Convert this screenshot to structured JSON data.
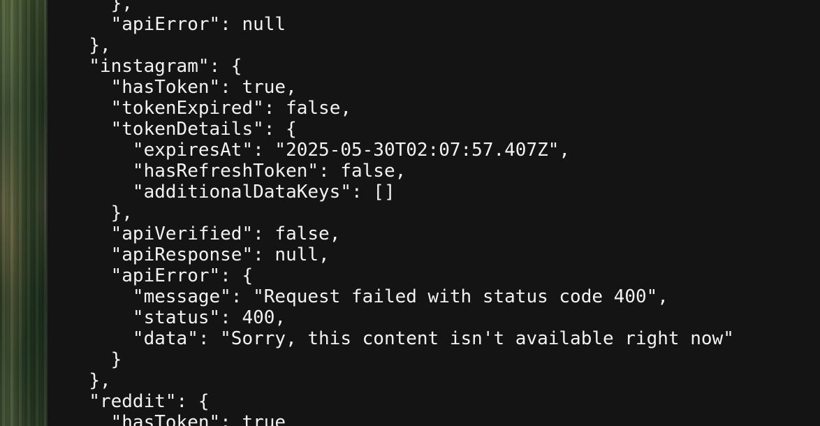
{
  "terminal": {
    "lines": [
      {
        "indent": "    ",
        "text": "},"
      },
      {
        "indent": "    ",
        "text": "\"apiError\": null"
      },
      {
        "indent": "  ",
        "text": "},"
      },
      {
        "indent": "  ",
        "text": "\"instagram\": {"
      },
      {
        "indent": "    ",
        "text": "\"hasToken\": true,"
      },
      {
        "indent": "    ",
        "text": "\"tokenExpired\": false,"
      },
      {
        "indent": "    ",
        "text": "\"tokenDetails\": {"
      },
      {
        "indent": "      ",
        "text": "\"expiresAt\": \"2025-05-30T02:07:57.407Z\","
      },
      {
        "indent": "      ",
        "text": "\"hasRefreshToken\": false,"
      },
      {
        "indent": "      ",
        "text": "\"additionalDataKeys\": []"
      },
      {
        "indent": "    ",
        "text": "},"
      },
      {
        "indent": "    ",
        "text": "\"apiVerified\": false,"
      },
      {
        "indent": "    ",
        "text": "\"apiResponse\": null,"
      },
      {
        "indent": "    ",
        "text": "\"apiError\": {"
      },
      {
        "indent": "      ",
        "text": "\"message\": \"Request failed with status code 400\","
      },
      {
        "indent": "      ",
        "text": "\"status\": 400,"
      },
      {
        "indent": "      ",
        "text": "\"data\": \"Sorry, this content isn't available right now\""
      },
      {
        "indent": "    ",
        "text": "}"
      },
      {
        "indent": "  ",
        "text": "},"
      },
      {
        "indent": "  ",
        "text": "\"reddit\": {"
      },
      {
        "indent": "    ",
        "text": "\"hasToken\": true"
      }
    ]
  },
  "colors": {
    "terminal_background": "#141414",
    "terminal_text": "#f2f2f2"
  }
}
